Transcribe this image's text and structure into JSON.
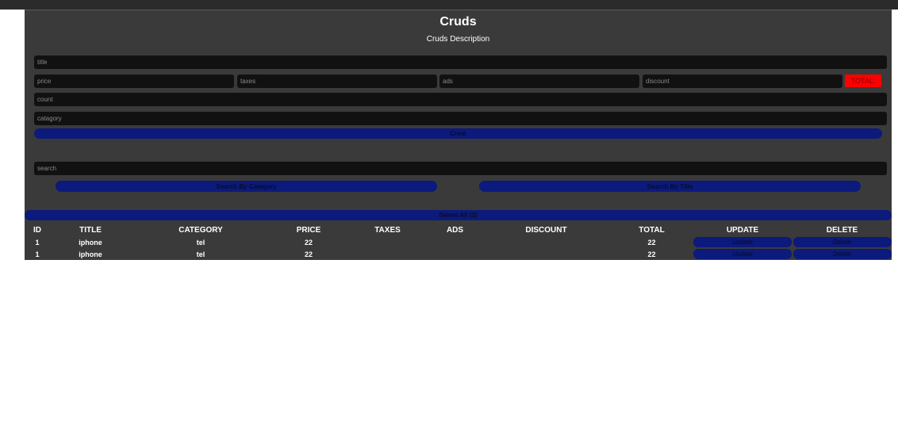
{
  "header": {
    "title": "Cruds",
    "description": "Cruds Description"
  },
  "form": {
    "title_placeholder": "title",
    "price_placeholder": "price",
    "taxes_placeholder": "taxes",
    "ads_placeholder": "ads",
    "discount_placeholder": "discount",
    "total_label": "TOTAL:",
    "count_placeholder": "count",
    "category_placeholder": "catagory",
    "create_label": "Creat"
  },
  "search": {
    "placeholder": "search",
    "by_category_label": "Search By Category",
    "by_title_label": "Search By Title"
  },
  "delete_all_label": "Delete All (2)",
  "table": {
    "headers": [
      "ID",
      "TITLE",
      "CATEGORY",
      "PRICE",
      "TAXES",
      "ADS",
      "DISCOUNT",
      "TOTAL",
      "UPDATE",
      "DELETE"
    ],
    "rows": [
      {
        "id": "1",
        "title": "iphone",
        "category": "tel",
        "price": "22",
        "taxes": "",
        "ads": "",
        "discount": "",
        "total": "22",
        "update_label": "Update",
        "delete_label": "Delete"
      },
      {
        "id": "1",
        "title": "iphone",
        "category": "tel",
        "price": "22",
        "taxes": "",
        "ads": "",
        "discount": "",
        "total": "22",
        "update_label": "Update",
        "delete_label": "Delete"
      }
    ]
  },
  "colors": {
    "background": "#3a3a3a",
    "input": "#111111",
    "button": "#0b1a7c",
    "total": "#ff0000"
  }
}
